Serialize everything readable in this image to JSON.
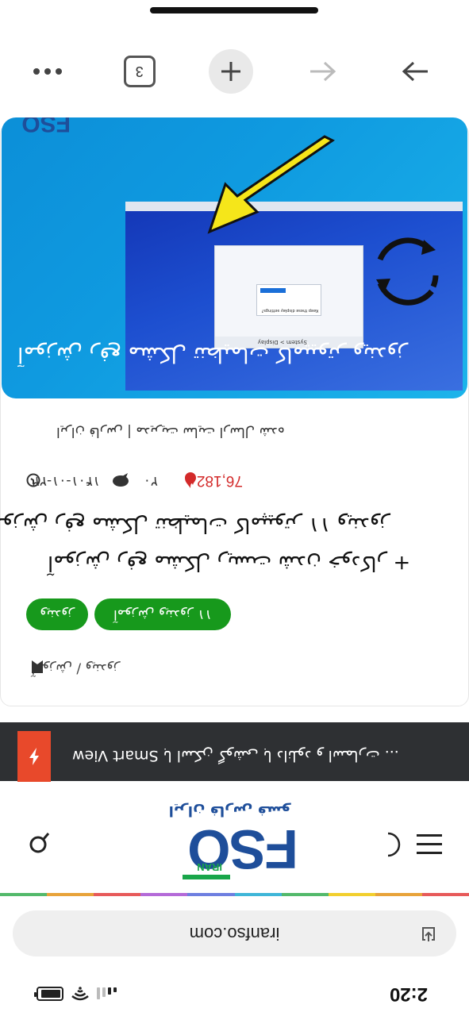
{
  "status_bar": {
    "time": "2:20"
  },
  "address_bar": {
    "url": "iranfso.com"
  },
  "site_header": {
    "logo_text": "FSO",
    "logo_sub": "IRAN",
    "logo_tagline": "ایران فارس فسو"
  },
  "ticker": {
    "text": "... با اسکن گوشی با دانلود و اسمارت Smart View"
  },
  "article": {
    "breadcrumb": "آموزش / ویندوز",
    "buttons": {
      "primary": "آموزش ویندوز ۱۱",
      "secondary": "ویندوز"
    },
    "title_line1": "+ آموزش رفع مشکل ریست شدن خودکار",
    "title_line2": "آموزش رفع مشکل تنظیمات کامپیوتر ۱۱ ویندوز",
    "meta_views": "76,182",
    "meta_comments": "۲۰",
    "meta_date": "۱۴۰۱-۰۱-۲۲",
    "meta_author": "ایران فارس | مدیریت سایت ارسال شده",
    "hero_caption": "آموزش رفع مشکل تنظیمات کامپیوتر ویندوز",
    "hero_brand": "FSO",
    "dialog_title": "Keep these display settings?",
    "dialog_crumb": "System > Display"
  },
  "toolbar": {
    "tab_count": "3"
  },
  "colors": {
    "accent_green": "#17991c",
    "ticker_bg": "#2e3033",
    "ticker_badge": "#e8492b",
    "logo_blue": "#1e4e9a",
    "logo_green": "#19a64a",
    "views_red": "#d32a2a"
  }
}
